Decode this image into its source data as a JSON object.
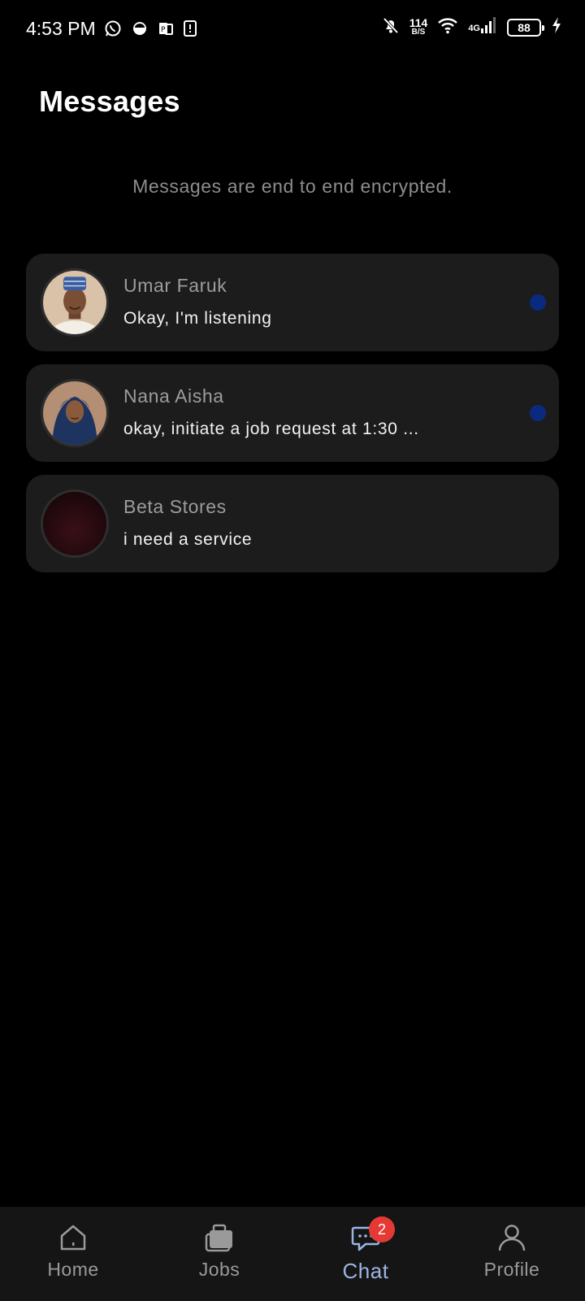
{
  "status_bar": {
    "time": "4:53 PM",
    "net_speed_value": "114",
    "net_speed_unit": "B/S",
    "network_type": "4G",
    "battery": "88",
    "icons": [
      "whatsapp-icon",
      "app-icon",
      "notes-icon",
      "sim-icon",
      "mute-bell-icon",
      "wifi-icon",
      "signal-icon",
      "battery-icon",
      "charging-icon"
    ]
  },
  "header": {
    "title": "Messages",
    "encryption_note": "Messages are end to end encrypted."
  },
  "conversations": [
    {
      "name": "Umar Faruk",
      "preview": "Okay, I'm listening",
      "unread": true
    },
    {
      "name": "Nana Aisha",
      "preview": "okay, initiate a job request at 1:30 ...",
      "unread": true
    },
    {
      "name": "Beta Stores",
      "preview": "i need a service",
      "unread": false
    }
  ],
  "bottom_nav": {
    "items": [
      {
        "label": "Home",
        "icon": "home-icon",
        "active": false
      },
      {
        "label": "Jobs",
        "icon": "briefcase-icon",
        "active": false
      },
      {
        "label": "Chat",
        "icon": "chat-icon",
        "active": true,
        "badge": "2"
      },
      {
        "label": "Profile",
        "icon": "person-icon",
        "active": false
      }
    ]
  },
  "colors": {
    "background": "#000000",
    "card": "#1c1c1c",
    "unread_dot": "#0a2a80",
    "accent": "#9bb5e3",
    "badge": "#e53935"
  }
}
